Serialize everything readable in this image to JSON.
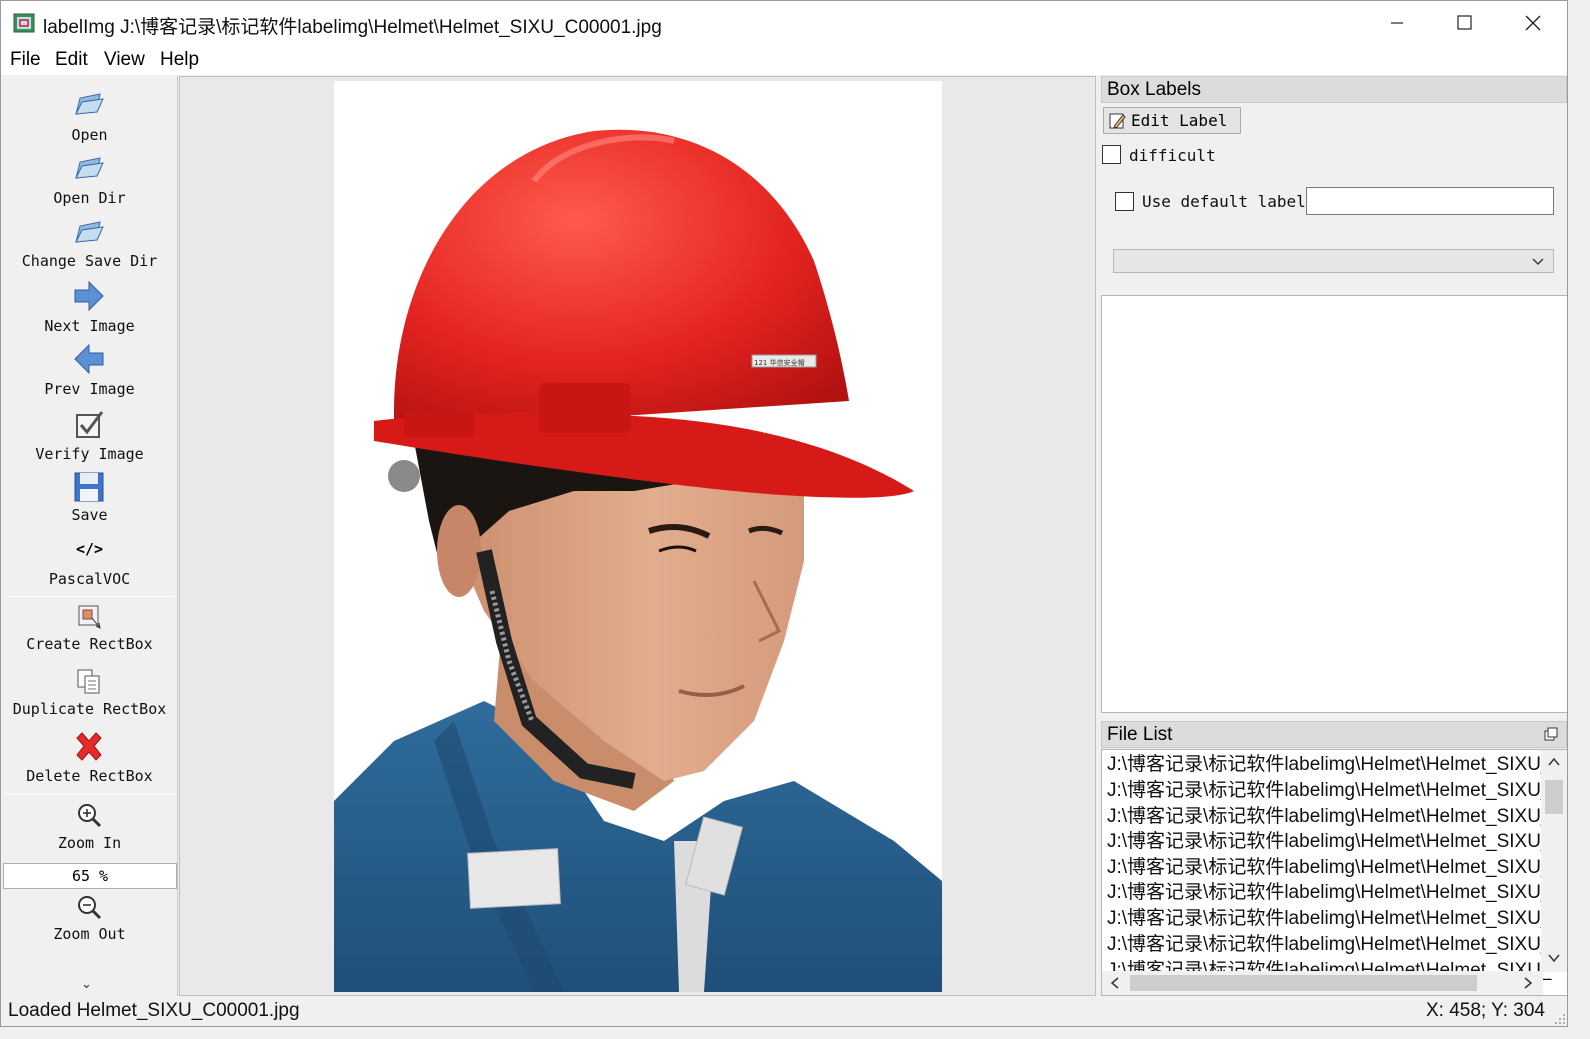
{
  "window": {
    "title": "labelImg J:\\博客记录\\标记软件labelimg\\Helmet\\Helmet_SIXU_C00001.jpg"
  },
  "menu": [
    "File",
    "Edit",
    "View",
    "Help"
  ],
  "toolbar": {
    "open": "Open",
    "open_dir": "Open Dir",
    "change_save_dir": "Change Save Dir",
    "next_image": "Next Image",
    "prev_image": "Prev Image",
    "verify_image": "Verify Image",
    "save": "Save",
    "format_icon_text": "</>",
    "format": "PascalVOC",
    "create_rectbox": "Create RectBox",
    "duplicate_rectbox": "Duplicate RectBox",
    "delete_rectbox": "Delete RectBox",
    "zoom_in": "Zoom In",
    "zoom_value": "65 %",
    "zoom_out": "Zoom Out",
    "expand": "⌄"
  },
  "image": {
    "helmet_sticker": "121 华信安全帽"
  },
  "box_labels": {
    "title": "Box Labels",
    "edit_label": "Edit Label",
    "difficult": "difficult",
    "use_default_label": "Use default label",
    "default_label_value": "",
    "combo_value": ""
  },
  "file_list": {
    "title": "File List",
    "items": [
      "J:\\博客记录\\标记软件labelimg\\Helmet\\Helmet_SIXU_",
      "J:\\博客记录\\标记软件labelimg\\Helmet\\Helmet_SIXU_",
      "J:\\博客记录\\标记软件labelimg\\Helmet\\Helmet_SIXU_",
      "J:\\博客记录\\标记软件labelimg\\Helmet\\Helmet_SIXU_",
      "J:\\博客记录\\标记软件labelimg\\Helmet\\Helmet_SIXU_",
      "J:\\博客记录\\标记软件labelimg\\Helmet\\Helmet_SIXU_",
      "J:\\博客记录\\标记软件labelimg\\Helmet\\Helmet_SIXU_",
      "J:\\博客记录\\标记软件labelimg\\Helmet\\Helmet_SIXU_",
      "J:\\博客记录\\标记软件labelimg\\Helmet\\Helmet_SIXU_"
    ]
  },
  "status": {
    "message": "Loaded Helmet_SIXU_C00001.jpg",
    "coords": "X: 458; Y: 304"
  },
  "colors": {
    "helmet": "#e3231f",
    "shirt": "#2b5f8c",
    "accent_blue": "#4a78c2"
  }
}
